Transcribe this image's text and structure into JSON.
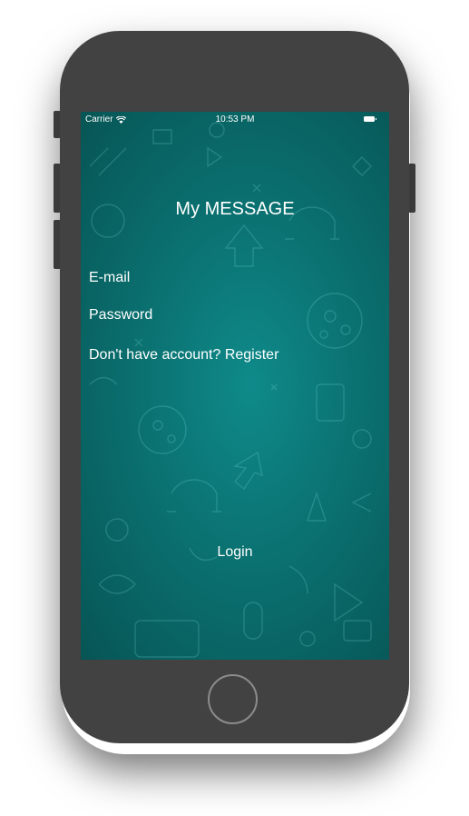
{
  "status_bar": {
    "carrier": "Carrier",
    "time": "10:53 PM",
    "wifi_icon": "wifi-icon",
    "battery_icon": "battery-icon"
  },
  "app": {
    "title": "My MESSAGE"
  },
  "form": {
    "email_placeholder": "E-mail",
    "password_placeholder": "Password",
    "register_label": "Don't have account? Register",
    "login_label": "Login"
  },
  "colors": {
    "background_teal": "#0b7171",
    "text": "#ffffff",
    "device_body": "#424242"
  }
}
